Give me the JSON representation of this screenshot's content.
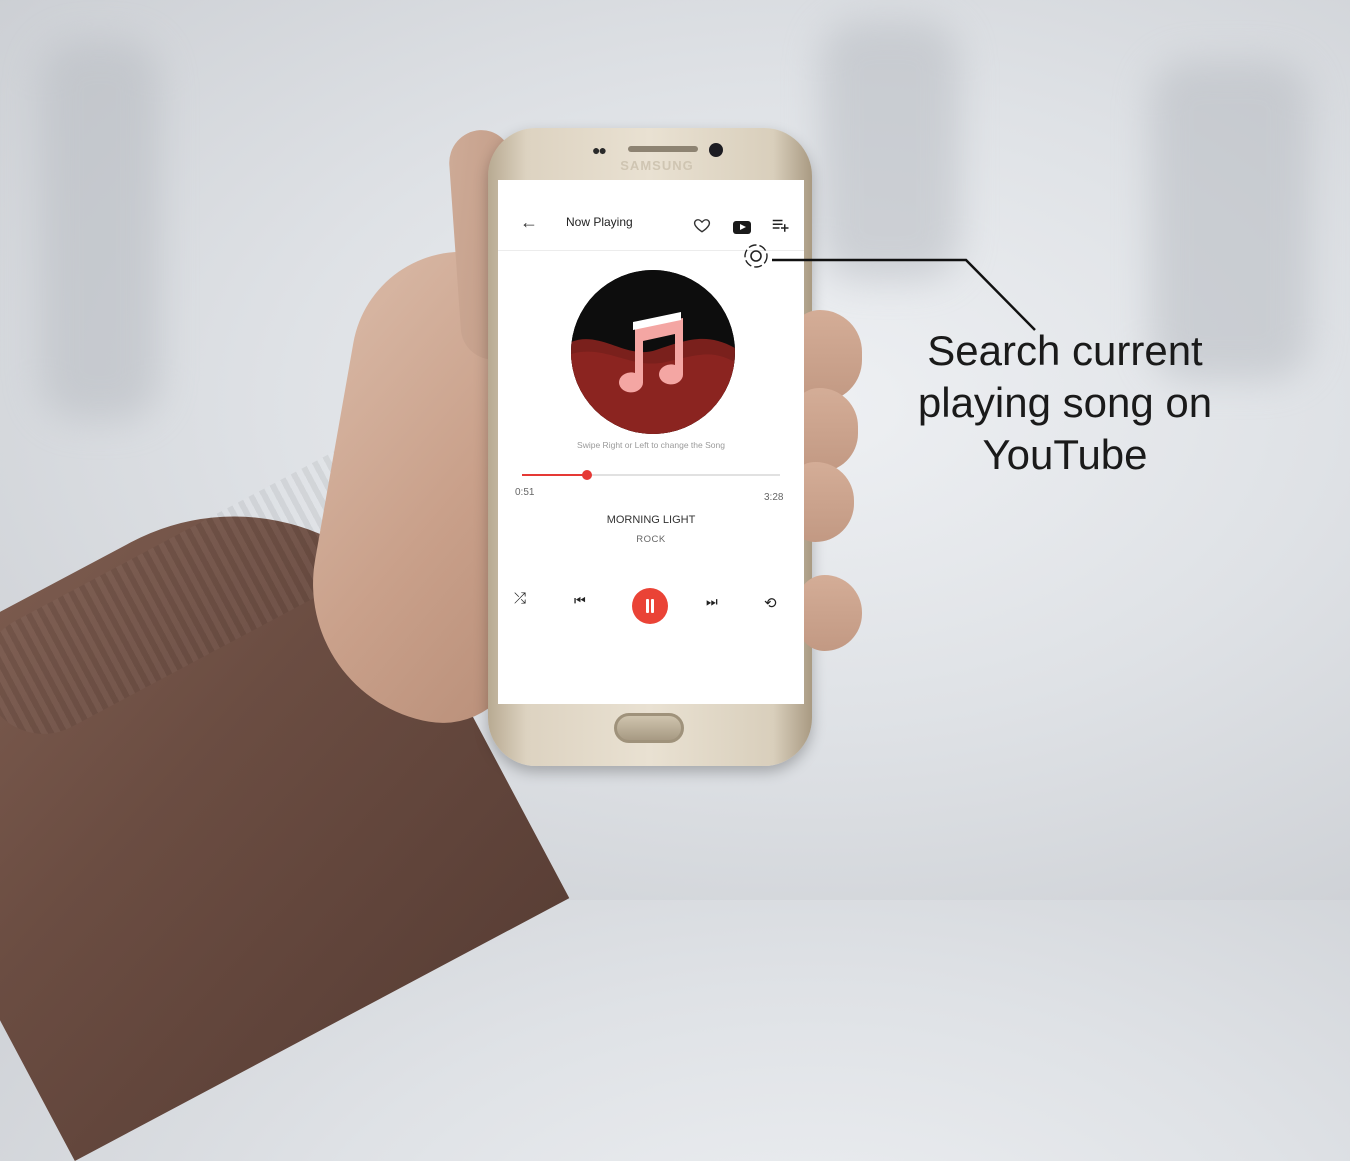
{
  "app": {
    "title": "Now Playing",
    "hint": "Swipe Right or Left to change the Song",
    "time_current": "0:51",
    "time_total": "3:28",
    "progress_fraction": 0.25,
    "song_title": "MORNING LIGHT",
    "genre": "ROCK",
    "accent_color": "#e53935"
  },
  "device": {
    "brand": "SAMSUNG"
  },
  "callout": {
    "text": "Search current playing song on YouTube"
  },
  "icons": [
    "arrow-back",
    "heart",
    "youtube",
    "add-to-queue",
    "search-youtube",
    "music-note",
    "shuffle",
    "skip-previous",
    "pause",
    "skip-next",
    "repeat"
  ]
}
